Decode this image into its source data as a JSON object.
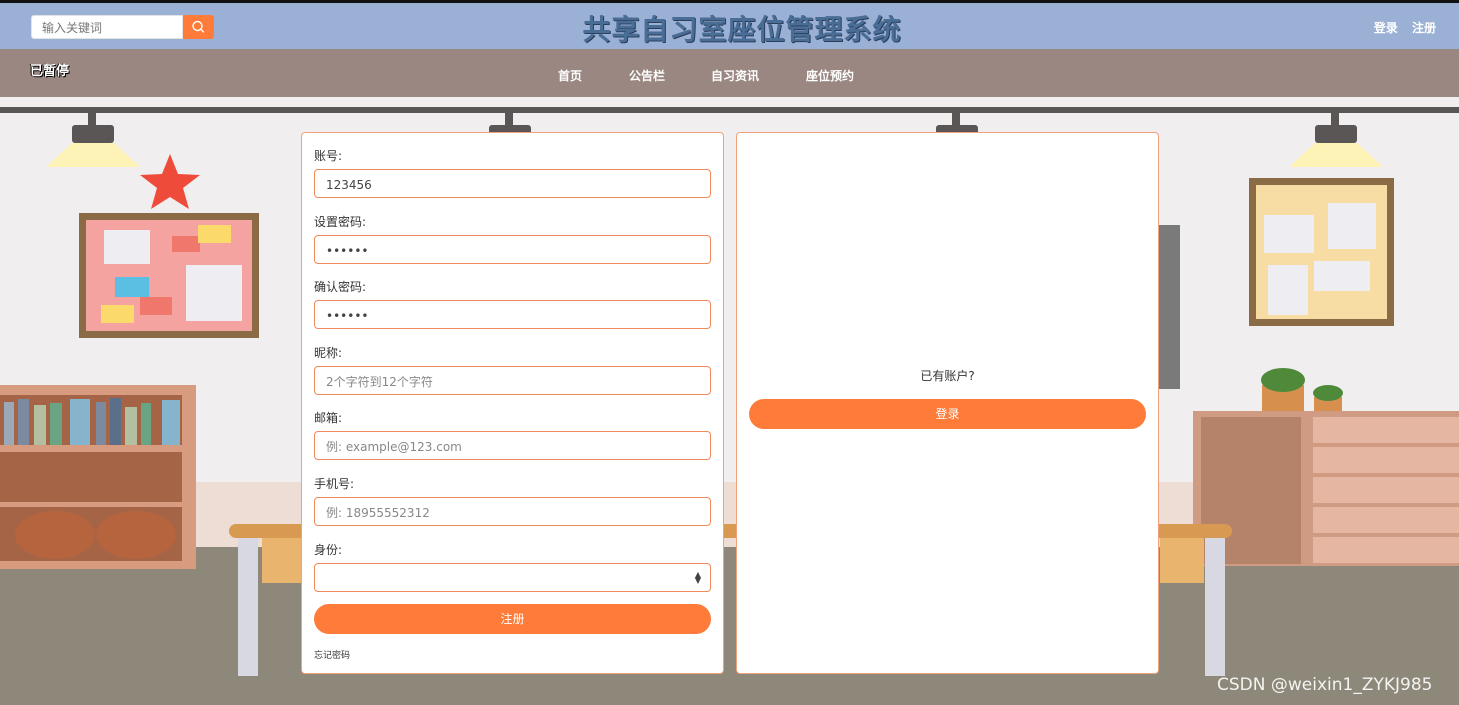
{
  "header": {
    "search_placeholder": "输入关键词",
    "site_title": "共享自习室座位管理系统",
    "login_link": "登录",
    "register_link": "注册"
  },
  "nav": {
    "status": "已暂停",
    "items": [
      "首页",
      "公告栏",
      "自习资讯",
      "座位预约"
    ]
  },
  "register_form": {
    "account": {
      "label": "账号:",
      "value": "123456"
    },
    "password": {
      "label": "设置密码:",
      "value": "••••••"
    },
    "confirm_password": {
      "label": "确认密码:",
      "value": "••••••"
    },
    "nickname": {
      "label": "昵称:",
      "placeholder": "2个字符到12个字符"
    },
    "email": {
      "label": "邮箱:",
      "placeholder": "例: example@123.com"
    },
    "phone": {
      "label": "手机号:",
      "placeholder": "例: 18955552312"
    },
    "role": {
      "label": "身份:",
      "value": ""
    },
    "submit_label": "注册",
    "forgot_label": "忘记密码"
  },
  "login_panel": {
    "prompt": "已有账户?",
    "login_label": "登录"
  },
  "watermark": "CSDN @weixin1_ZYKJ985",
  "colors": {
    "header_bg": "#9ab0d4",
    "nav_bg": "#9a8781",
    "accent": "#ff7b3a",
    "title": "#4a6d96"
  }
}
